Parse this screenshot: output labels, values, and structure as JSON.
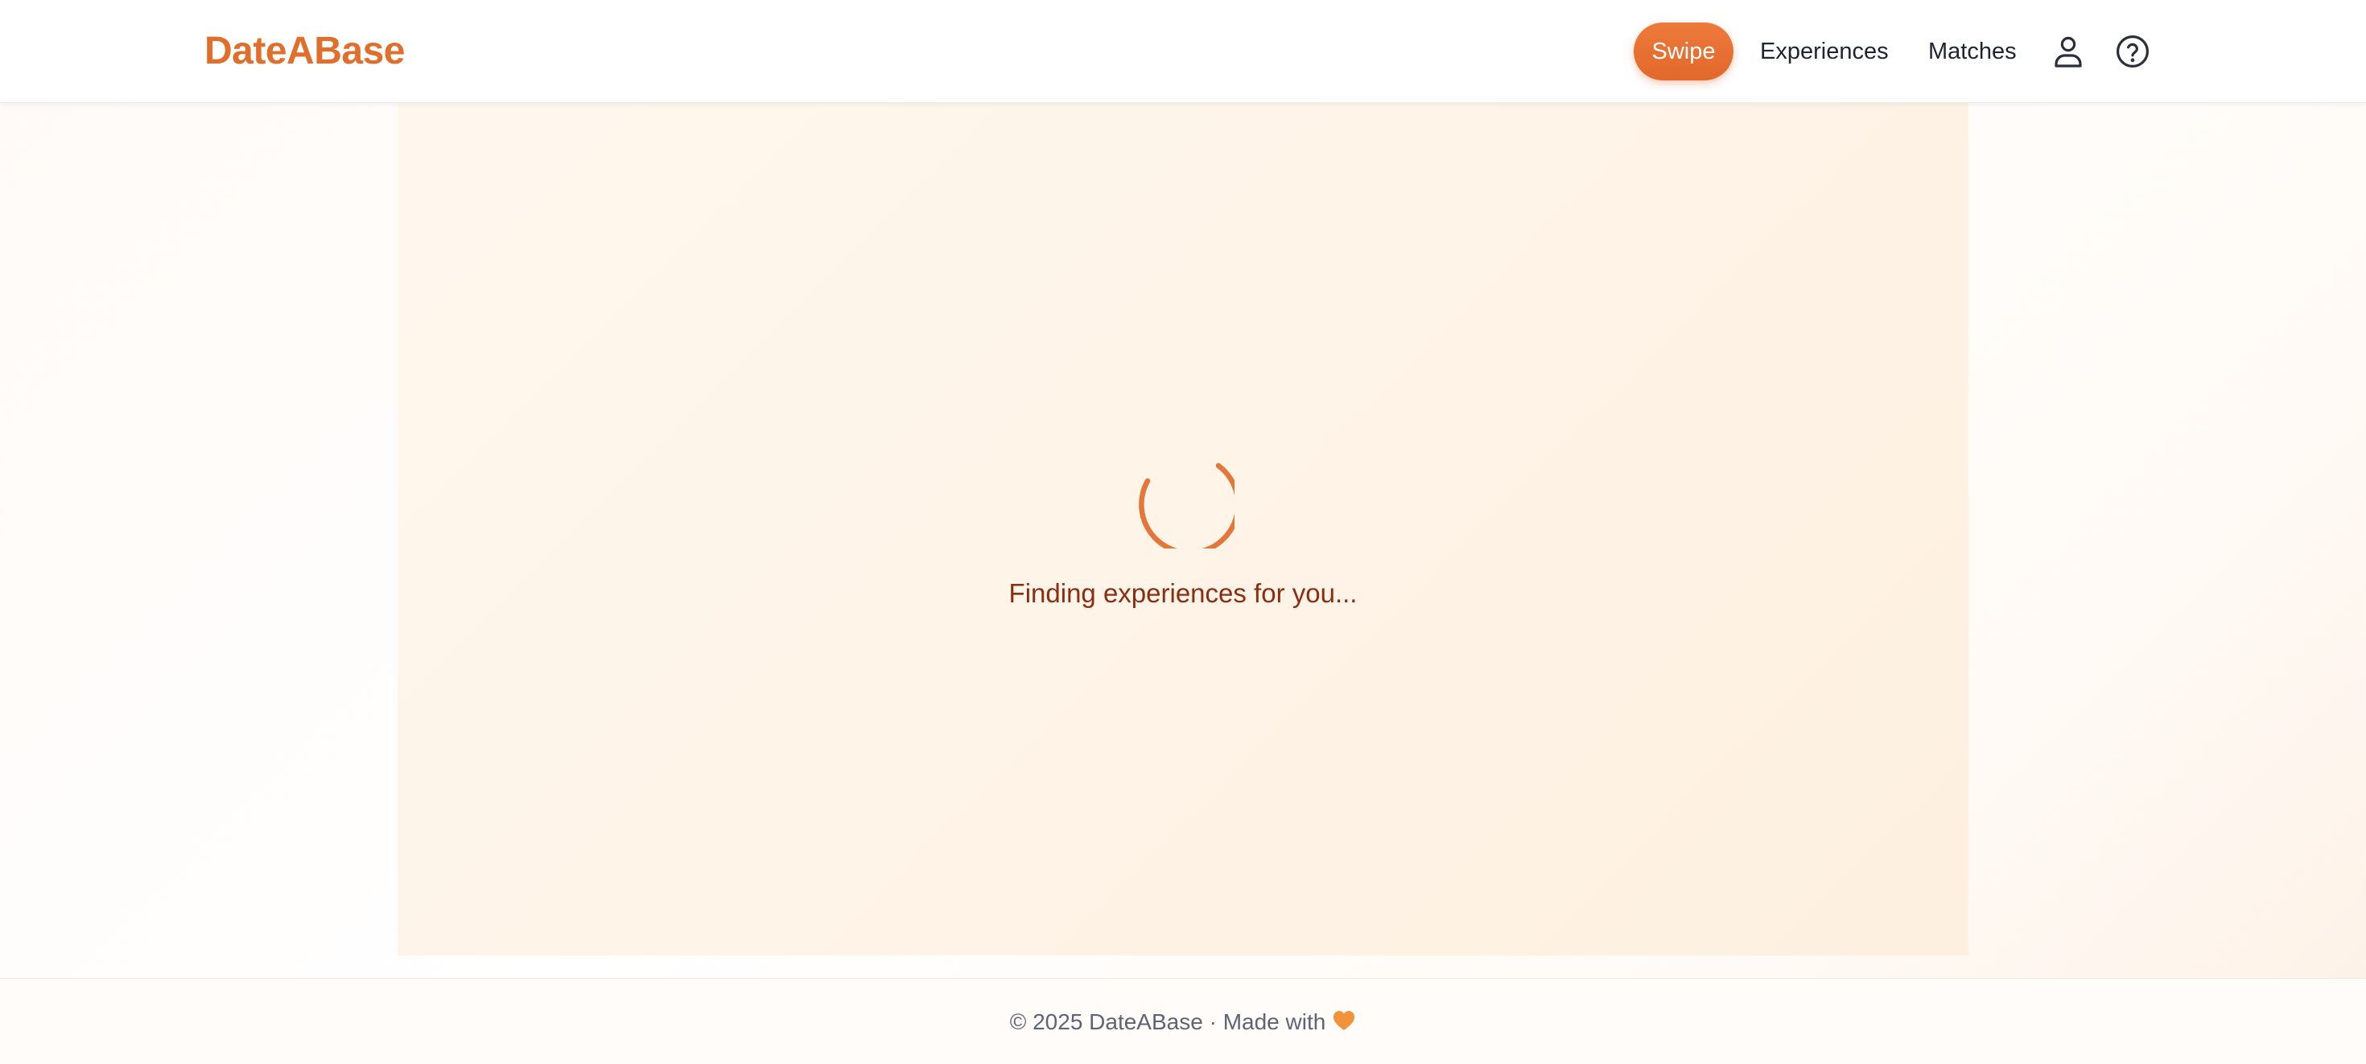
{
  "brand": {
    "name": "DateABase",
    "color": "#e06f2c"
  },
  "nav": {
    "swipe_label": "Swipe",
    "experiences_label": "Experiences",
    "matches_label": "Matches",
    "active": "Swipe",
    "icons": [
      "user-icon",
      "help-icon"
    ]
  },
  "main": {
    "loading_text": "Finding experiences for you...",
    "spinner_color": "#e4763a",
    "text_color": "#8a2e12"
  },
  "footer": {
    "text": "© 2025 DateABase · Made with",
    "icon": "orange-heart-icon"
  }
}
